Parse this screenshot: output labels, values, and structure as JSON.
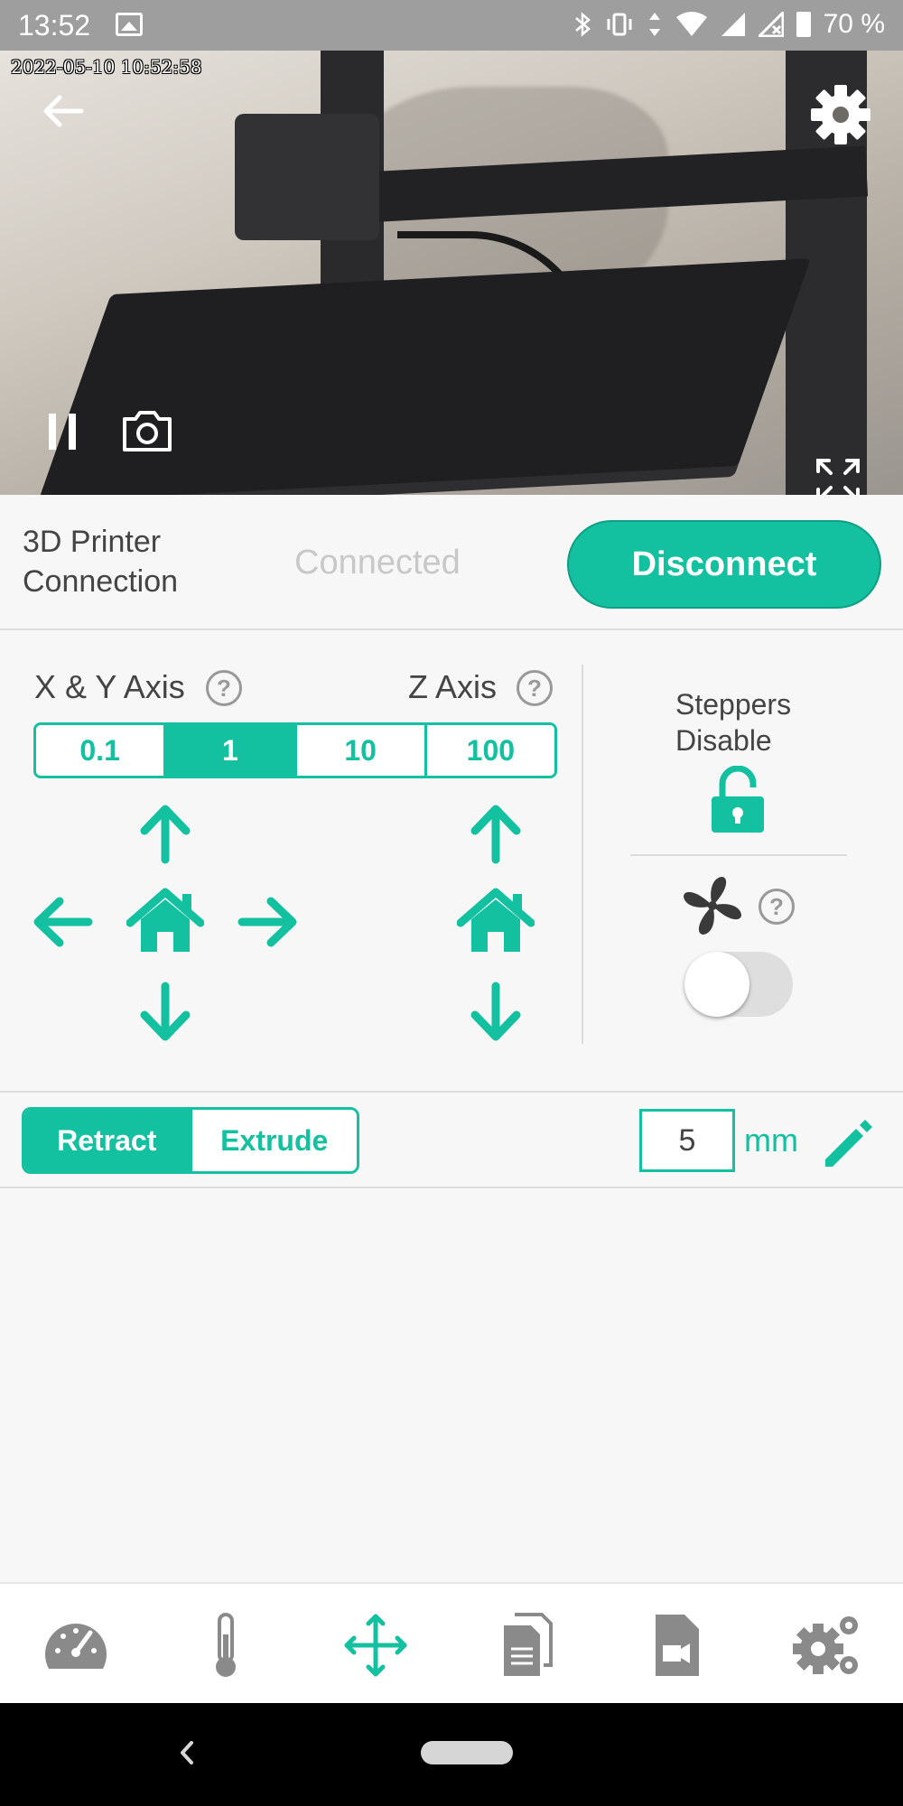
{
  "status_bar": {
    "time": "13:52",
    "battery": "70 %",
    "icons": [
      "image-icon",
      "bluetooth-icon",
      "vibrate-icon",
      "data-icon",
      "wifi-icon",
      "signal-icon",
      "signal-x-icon",
      "battery-icon"
    ]
  },
  "camera": {
    "timestamp": "2022-05-10 10:52:58"
  },
  "connection": {
    "label_line1": "3D Printer",
    "label_line2": "Connection",
    "status": "Connected",
    "button": "Disconnect"
  },
  "axis": {
    "xy_title": "X & Y Axis",
    "z_title": "Z Axis",
    "help": "?",
    "steps": [
      "0.1",
      "1",
      "10",
      "100"
    ],
    "selected_step": "1"
  },
  "steppers": {
    "line1": "Steppers",
    "line2": "Disable"
  },
  "fan": {
    "enabled": false
  },
  "extruder": {
    "retract": "Retract",
    "extrude": "Extrude",
    "selected": "Retract",
    "amount": "5",
    "unit": "mm"
  },
  "bottom_nav": [
    "dashboard-icon",
    "thermometer-icon",
    "move-icon",
    "files-icon",
    "video-file-icon",
    "settings-icon"
  ],
  "colors": {
    "accent": "#13c0a0",
    "text": "#444444",
    "muted": "#999999"
  }
}
